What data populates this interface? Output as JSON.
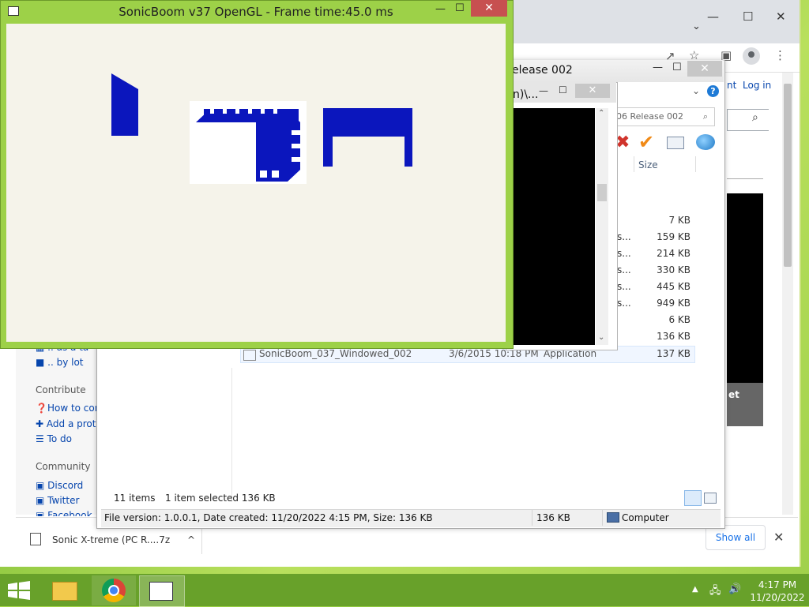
{
  "sonic": {
    "title": "SonicBoom v37 OpenGL - Frame time:45.0 ms",
    "minimize": "—",
    "maximize": "☐",
    "close": "✕"
  },
  "browser": {
    "tab_chevron": "⌄",
    "win_minimize": "—",
    "win_maximize": "☐",
    "win_close": "✕",
    "toolbar_icons": [
      "share-icon",
      "star-icon",
      "sidebar-icon",
      "profile-icon",
      "menu-icon"
    ],
    "login_partial": "nt",
    "login": "Log in",
    "wiki_side": {
      "items_top": [
        ".. as a ta",
        ".. by lot"
      ],
      "contribute_head": "Contribute",
      "contribute": [
        "How to cont",
        "Add a protot",
        "To do"
      ],
      "community_head": "Community",
      "community": [
        "Discord",
        "Twitter",
        "Facebook"
      ]
    },
    "promo_partial": "et",
    "download": {
      "file": "Sonic X-treme (PC R....7z",
      "chevron": "^",
      "show_all": "Show all",
      "close": "✕"
    }
  },
  "explorer": {
    "title": "elease 002",
    "path_partial": "n)\\...",
    "search_placeholder": "06 Release 002",
    "help": "?",
    "size_header": "Size",
    "rows": [
      {
        "dots": "",
        "size": "7 KB"
      },
      {
        "dots": "s...",
        "size": "159 KB"
      },
      {
        "dots": "s...",
        "size": "214 KB"
      },
      {
        "dots": "s...",
        "size": "330 KB"
      },
      {
        "dots": "s...",
        "size": "445 KB"
      },
      {
        "dots": "s...",
        "size": "949 KB"
      },
      {
        "dots": "",
        "size": "6 KB"
      },
      {
        "dots": "",
        "size": "136 KB"
      }
    ],
    "selected_row": {
      "name": "SonicBoom_037_Windowed_002",
      "date": "3/6/2015 10:18 PM",
      "type": "Application",
      "size": "137 KB"
    },
    "status_items": "11 items",
    "status_selected": "1 item selected  136 KB",
    "info_text": "File version: 1.0.0.1, Date created: 11/20/2022 4:15 PM, Size: 136 KB",
    "info_size": "136 KB",
    "info_location": "Computer"
  },
  "console": {
    "title_partial": "—",
    "close": "✕"
  },
  "taskbar": {
    "time": "4:17 PM",
    "date": "11/20/2022",
    "tray_icons": [
      "show-hidden-icons-icon",
      "network-icon",
      "volume-icon"
    ]
  }
}
